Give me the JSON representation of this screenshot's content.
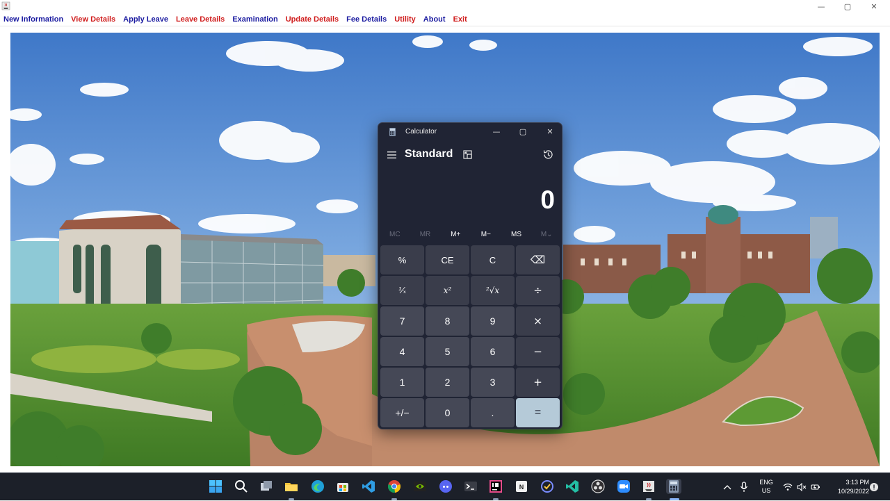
{
  "menu": [
    {
      "label": "New Information",
      "color": "blue"
    },
    {
      "label": "View Details",
      "color": "red"
    },
    {
      "label": "Apply Leave",
      "color": "blue"
    },
    {
      "label": "Leave Details",
      "color": "red"
    },
    {
      "label": "Examination",
      "color": "blue"
    },
    {
      "label": "Update Details",
      "color": "red"
    },
    {
      "label": "Fee Details",
      "color": "blue"
    },
    {
      "label": "Utility",
      "color": "red"
    },
    {
      "label": "About",
      "color": "blue"
    },
    {
      "label": "Exit",
      "color": "red"
    }
  ],
  "window_controls": {
    "minimize": "—",
    "maximize": "▢",
    "close": "✕"
  },
  "calculator": {
    "title": "Calculator",
    "mode": "Standard",
    "display": "0",
    "memory": [
      {
        "label": "MC",
        "enabled": false
      },
      {
        "label": "MR",
        "enabled": false
      },
      {
        "label": "M+",
        "enabled": true
      },
      {
        "label": "M−",
        "enabled": true
      },
      {
        "label": "MS",
        "enabled": true
      },
      {
        "label": "M⌄",
        "enabled": false
      }
    ],
    "keys": [
      {
        "label": "%",
        "kind": "fn",
        "name": "percent-key"
      },
      {
        "label": "CE",
        "kind": "fn",
        "name": "clear-entry-key"
      },
      {
        "label": "C",
        "kind": "fn",
        "name": "clear-key"
      },
      {
        "label": "⌫",
        "kind": "op",
        "name": "backspace-key"
      },
      {
        "label": "¹⁄ₓ",
        "kind": "ital",
        "name": "reciprocal-key"
      },
      {
        "label": "x²",
        "kind": "ital",
        "name": "square-key"
      },
      {
        "label": "²√x",
        "kind": "ital",
        "name": "square-root-key"
      },
      {
        "label": "÷",
        "kind": "op",
        "name": "divide-key"
      },
      {
        "label": "7",
        "kind": "num",
        "name": "digit-7-key"
      },
      {
        "label": "8",
        "kind": "num",
        "name": "digit-8-key"
      },
      {
        "label": "9",
        "kind": "num",
        "name": "digit-9-key"
      },
      {
        "label": "×",
        "kind": "op",
        "name": "multiply-key"
      },
      {
        "label": "4",
        "kind": "num",
        "name": "digit-4-key"
      },
      {
        "label": "5",
        "kind": "num",
        "name": "digit-5-key"
      },
      {
        "label": "6",
        "kind": "num",
        "name": "digit-6-key"
      },
      {
        "label": "−",
        "kind": "op",
        "name": "subtract-key"
      },
      {
        "label": "1",
        "kind": "num",
        "name": "digit-1-key"
      },
      {
        "label": "2",
        "kind": "num",
        "name": "digit-2-key"
      },
      {
        "label": "3",
        "kind": "num",
        "name": "digit-3-key"
      },
      {
        "label": "+",
        "kind": "op",
        "name": "add-key"
      },
      {
        "label": "+/−",
        "kind": "num",
        "name": "negate-key"
      },
      {
        "label": "0",
        "kind": "num",
        "name": "digit-0-key"
      },
      {
        "label": ".",
        "kind": "num",
        "name": "decimal-key"
      },
      {
        "label": "=",
        "kind": "eq",
        "name": "equals-key"
      }
    ]
  },
  "taskbar": {
    "apps": [
      "start-icon",
      "search-icon",
      "task-view-icon",
      "file-explorer-icon",
      "edge-icon",
      "store-icon",
      "vscode-icon",
      "chrome-icon",
      "nvidia-icon",
      "discord-icon",
      "terminal-icon",
      "intellij-icon",
      "notepad-icon",
      "todo-icon",
      "vscode-insiders-icon",
      "obs-icon",
      "zoom-icon",
      "java-app-icon",
      "calculator-icon"
    ],
    "lang_line1": "ENG",
    "lang_line2": "US",
    "time": "3:13 PM",
    "date": "10/29/2022"
  },
  "colors": {
    "menu_blue": "#1a1aa0",
    "menu_red": "#d01c1c",
    "calc_bg": "#202434",
    "equals_bg": "#b5cad8",
    "taskbar_bg": "#1c2029"
  }
}
